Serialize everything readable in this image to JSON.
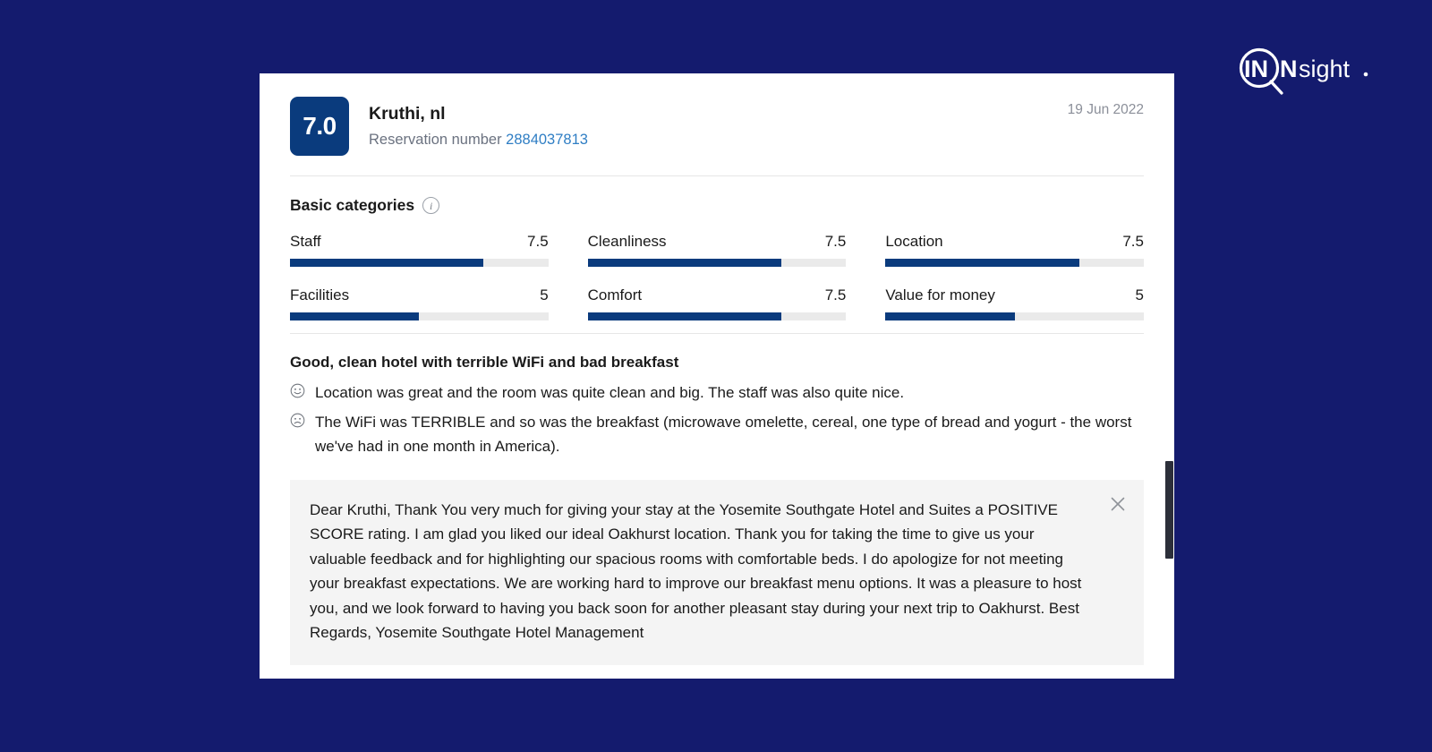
{
  "brand": {
    "name": "INNsight",
    "logo_icon": "magnifier-logo-icon",
    "accent_color": "#141b6e"
  },
  "page": {
    "background_color": "#141b6e",
    "card_background": "#ffffff"
  },
  "review": {
    "score": "7.0",
    "score_badge_color": "#0a3b7d",
    "guest_name": "Kruthi, nl",
    "reservation_label": "Reservation number",
    "reservation_number": "2884037813",
    "reservation_number_color": "#2f7ec4",
    "date": "19 Jun 2022",
    "title": "Good, clean hotel with terrible WiFi and bad breakfast",
    "positive_icon": "smiley-face-icon",
    "positive_comment": "Location was great and the room was quite clean and big. The staff was also quite nice.",
    "negative_icon": "frowny-face-icon",
    "negative_comment": "The WiFi was TERRIBLE and so was the breakfast (microwave omelette, cereal, one type of bread and yogurt - the worst we've had in one month in America)."
  },
  "categories": {
    "section_title": "Basic categories",
    "info_icon": "info-icon",
    "info_glyph": "i",
    "items": [
      {
        "label": "Staff",
        "score": "7.5",
        "percent": 75
      },
      {
        "label": "Cleanliness",
        "score": "7.5",
        "percent": 75
      },
      {
        "label": "Location",
        "score": "7.5",
        "percent": 75
      },
      {
        "label": "Facilities",
        "score": "5",
        "percent": 50
      },
      {
        "label": "Comfort",
        "score": "7.5",
        "percent": 75
      },
      {
        "label": "Value for money",
        "score": "5",
        "percent": 50
      }
    ]
  },
  "response": {
    "close_icon": "close-icon",
    "text": "Dear Kruthi, Thank You very much for giving your stay at the Yosemite Southgate Hotel and Suites a POSITIVE SCORE rating. I am glad you liked our ideal Oakhurst location. Thank you for taking the time to give us your valuable feedback and for highlighting our spacious rooms with comfortable beds. I do apologize for not meeting your breakfast expectations. We are working hard to improve our breakfast menu options. It was a pleasure to host you, and we look forward to having you back soon for another pleasant stay during your next trip to Oakhurst. Best Regards, Yosemite Southgate Hotel Management"
  }
}
